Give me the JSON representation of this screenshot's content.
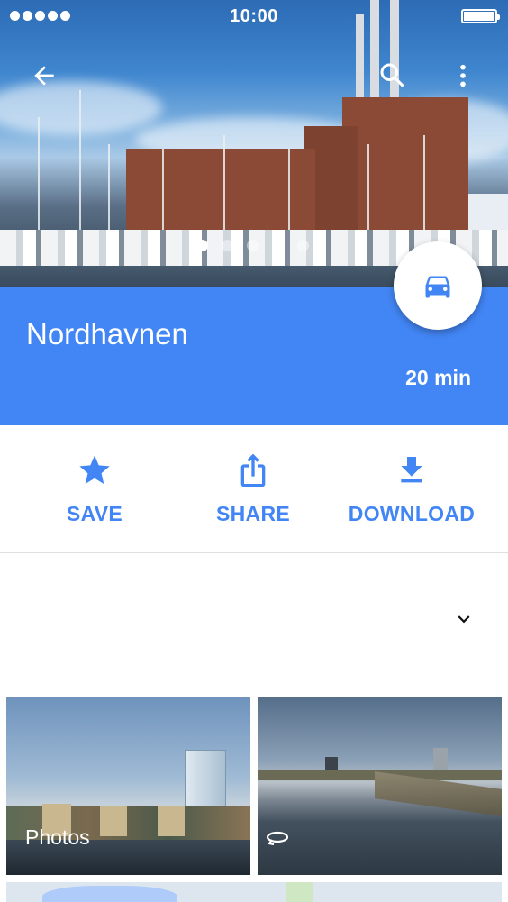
{
  "status_bar": {
    "time": "10:00"
  },
  "header": {
    "back_icon": "arrow-left-icon",
    "search_icon": "search-icon",
    "more_icon": "more-vert-icon"
  },
  "carousel": {
    "count": 5,
    "active_index": 0
  },
  "place": {
    "name": "Nordhavnen",
    "travel_time": "20 min",
    "travel_mode_icon": "car-icon"
  },
  "actions": [
    {
      "label": "SAVE",
      "icon": "star-icon"
    },
    {
      "label": "SHARE",
      "icon": "share-icon"
    },
    {
      "label": "DOWNLOAD",
      "icon": "download-icon"
    }
  ],
  "expand": {
    "icon": "chevron-down-icon"
  },
  "photos": {
    "label": "Photos",
    "streetview_icon": "360-rotate-icon"
  },
  "colors": {
    "accent": "#4285f4",
    "text_on_accent": "#ffffff"
  }
}
